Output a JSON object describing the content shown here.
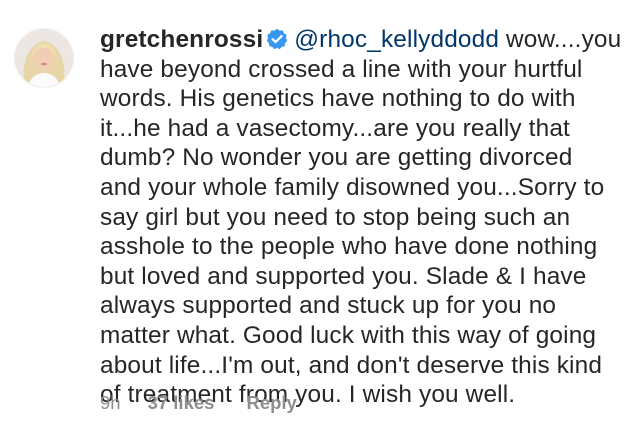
{
  "comment": {
    "username": "gretchenrossi",
    "verified": true,
    "mention": "@rhoc_kellyddodd",
    "text_first": " wow....you",
    "lines": [
      "have beyond crossed a line with your hurtful",
      "words. His genetics have nothing to do with",
      "it...he had a vasectomy...are you really that",
      "dumb? No wonder you are getting divorced",
      "and your whole family disowned you...Sorry to",
      "say girl but you need to stop being such an",
      "asshole to the people who have done nothing",
      "but loved and supported you. Slade & I have",
      "always supported and stuck up for you no",
      "matter what. Good luck with this way of going",
      "about life...I'm out, and don't deserve this kind",
      "of treatment from you.  I wish you well."
    ],
    "time": "9h",
    "likes": "37 likes",
    "reply_label": "Reply"
  },
  "colors": {
    "text": "#262626",
    "mention": "#00376b",
    "meta": "#8e8e8e",
    "verified_badge": "#3897f0"
  },
  "icons": {
    "avatar": "profile-avatar",
    "verified": "verified-badge-icon"
  }
}
